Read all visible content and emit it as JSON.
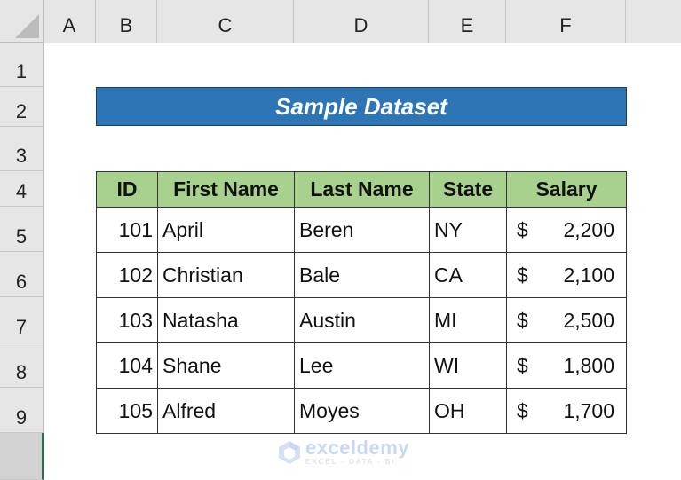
{
  "sheet": {
    "columns": [
      "A",
      "B",
      "C",
      "D",
      "E",
      "F"
    ],
    "rows": [
      "1",
      "2",
      "3",
      "4",
      "5",
      "6",
      "7",
      "8",
      "9",
      ""
    ],
    "selected_row_index": 9
  },
  "title": "Sample Dataset",
  "table": {
    "headers": [
      "ID",
      "First Name",
      "Last Name",
      "State",
      "Salary"
    ],
    "rows": [
      {
        "id": "101",
        "first": "April",
        "last": "Beren",
        "state": "NY",
        "currency": "$",
        "salary": "2,200"
      },
      {
        "id": "102",
        "first": "Christian",
        "last": "Bale",
        "state": "CA",
        "currency": "$",
        "salary": "2,100"
      },
      {
        "id": "103",
        "first": "Natasha",
        "last": "Austin",
        "state": "MI",
        "currency": "$",
        "salary": "2,500"
      },
      {
        "id": "104",
        "first": "Shane",
        "last": "Lee",
        "state": "WI",
        "currency": "$",
        "salary": "1,800"
      },
      {
        "id": "105",
        "first": "Alfred",
        "last": "Moyes",
        "state": "OH",
        "currency": "$",
        "salary": "1,700"
      }
    ]
  },
  "watermark": {
    "brand": "exceldemy",
    "tagline": "EXCEL · DATA · BI",
    "icon": "exceldemy-logo-icon"
  },
  "colors": {
    "title_bg": "#2e75b6",
    "header_bg": "#a9d18e",
    "selection_accent": "#217346"
  }
}
